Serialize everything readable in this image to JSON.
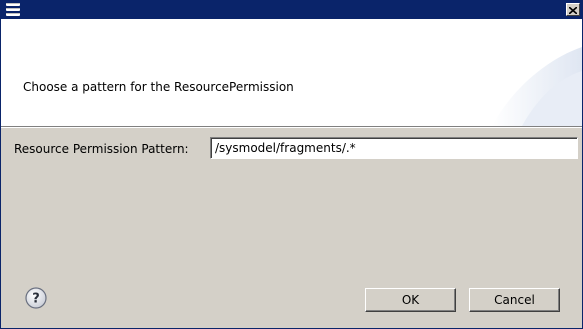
{
  "window": {
    "title": "",
    "close_glyph": "×"
  },
  "banner": {
    "message": "Choose a pattern for the ResourcePermission"
  },
  "form": {
    "label": "Resource Permission Pattern:",
    "value": "/sysmodel/fragments/.*"
  },
  "buttons": {
    "help_glyph": "?",
    "ok_label": "OK",
    "cancel_label": "Cancel"
  },
  "colors": {
    "titlebar": "#0a246a",
    "dialog_bg": "#d4d0c8",
    "banner_bg": "#ffffff"
  },
  "icons": {
    "window_icon": "window-menu-icon",
    "help_icon": "help-icon",
    "close_icon": "close-icon"
  }
}
